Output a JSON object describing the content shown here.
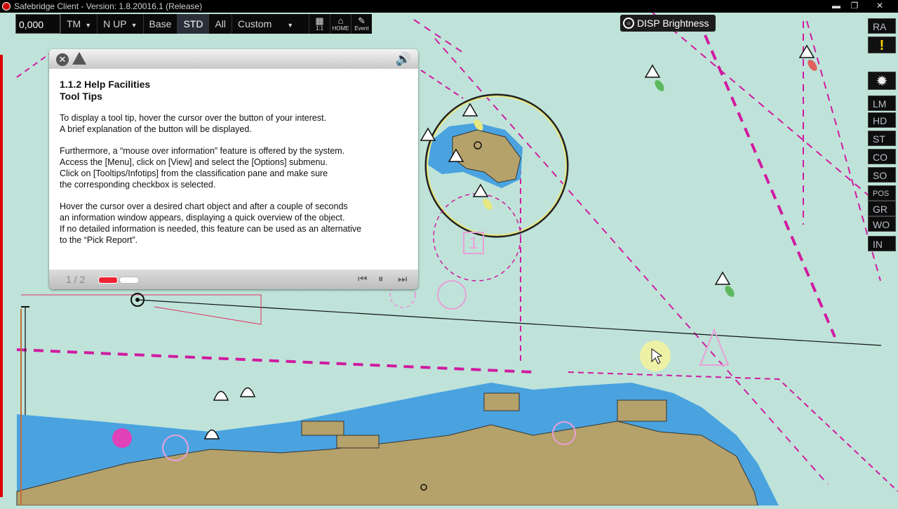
{
  "window": {
    "title": "Safebridge Client - Version: 1.8.20016.1 (Release)",
    "min": "▬",
    "max": "❐",
    "close": "✕"
  },
  "toolbar": {
    "scale": "0,000",
    "motion": "TM",
    "orientation": "N UP",
    "display_base": "Base",
    "display_std": "STD",
    "display_all": "All",
    "display_custom": "Custom",
    "icon_11_label": "1:1",
    "icon_home_label": "HOME",
    "icon_event_label": "Event"
  },
  "disp_brightness": {
    "label": "DISP Brightness"
  },
  "right_panel": {
    "items": [
      "RA",
      "LM",
      "HD",
      "ST",
      "CO",
      "SO",
      "POS",
      "GR",
      "WO",
      "IN"
    ],
    "warning": "!",
    "gear": "✹"
  },
  "help": {
    "title_line1": "1.1.2 Help Facilities",
    "title_line2": "Tool Tips",
    "p1": "To display a tool tip, hover the cursor over the button of your interest.\nA brief explanation of the button will be displayed.",
    "p2": "Furthermore, a “mouse over information” feature is offered by the system.\nAccess the [Menu], click on [View] and select the [Options] submenu.\nClick on [Tooltips/Infotips] from the classification pane and make sure\nthe corresponding checkbox is selected.",
    "p3": "Hover the cursor over a desired chart object and after a couple of seconds\nan information window appears, displaying a quick overview of the object.\nIf no detailed information is needed, this feature can be used as an alternative\nto the “Pick Report”.",
    "page": "1 / 2",
    "prev_icon": "⏮",
    "pause_icon": "⏸",
    "next_icon": "⏭",
    "sound_icon": "🔊",
    "close_icon": "✕"
  },
  "chart": {
    "anchorage_label": "1"
  },
  "colors": {
    "sea": "#bfe3d9",
    "shallow": "#4aa3df",
    "land": "#b5a16a",
    "magenta": "#d01aa0",
    "panel": "#0d0d0d"
  }
}
